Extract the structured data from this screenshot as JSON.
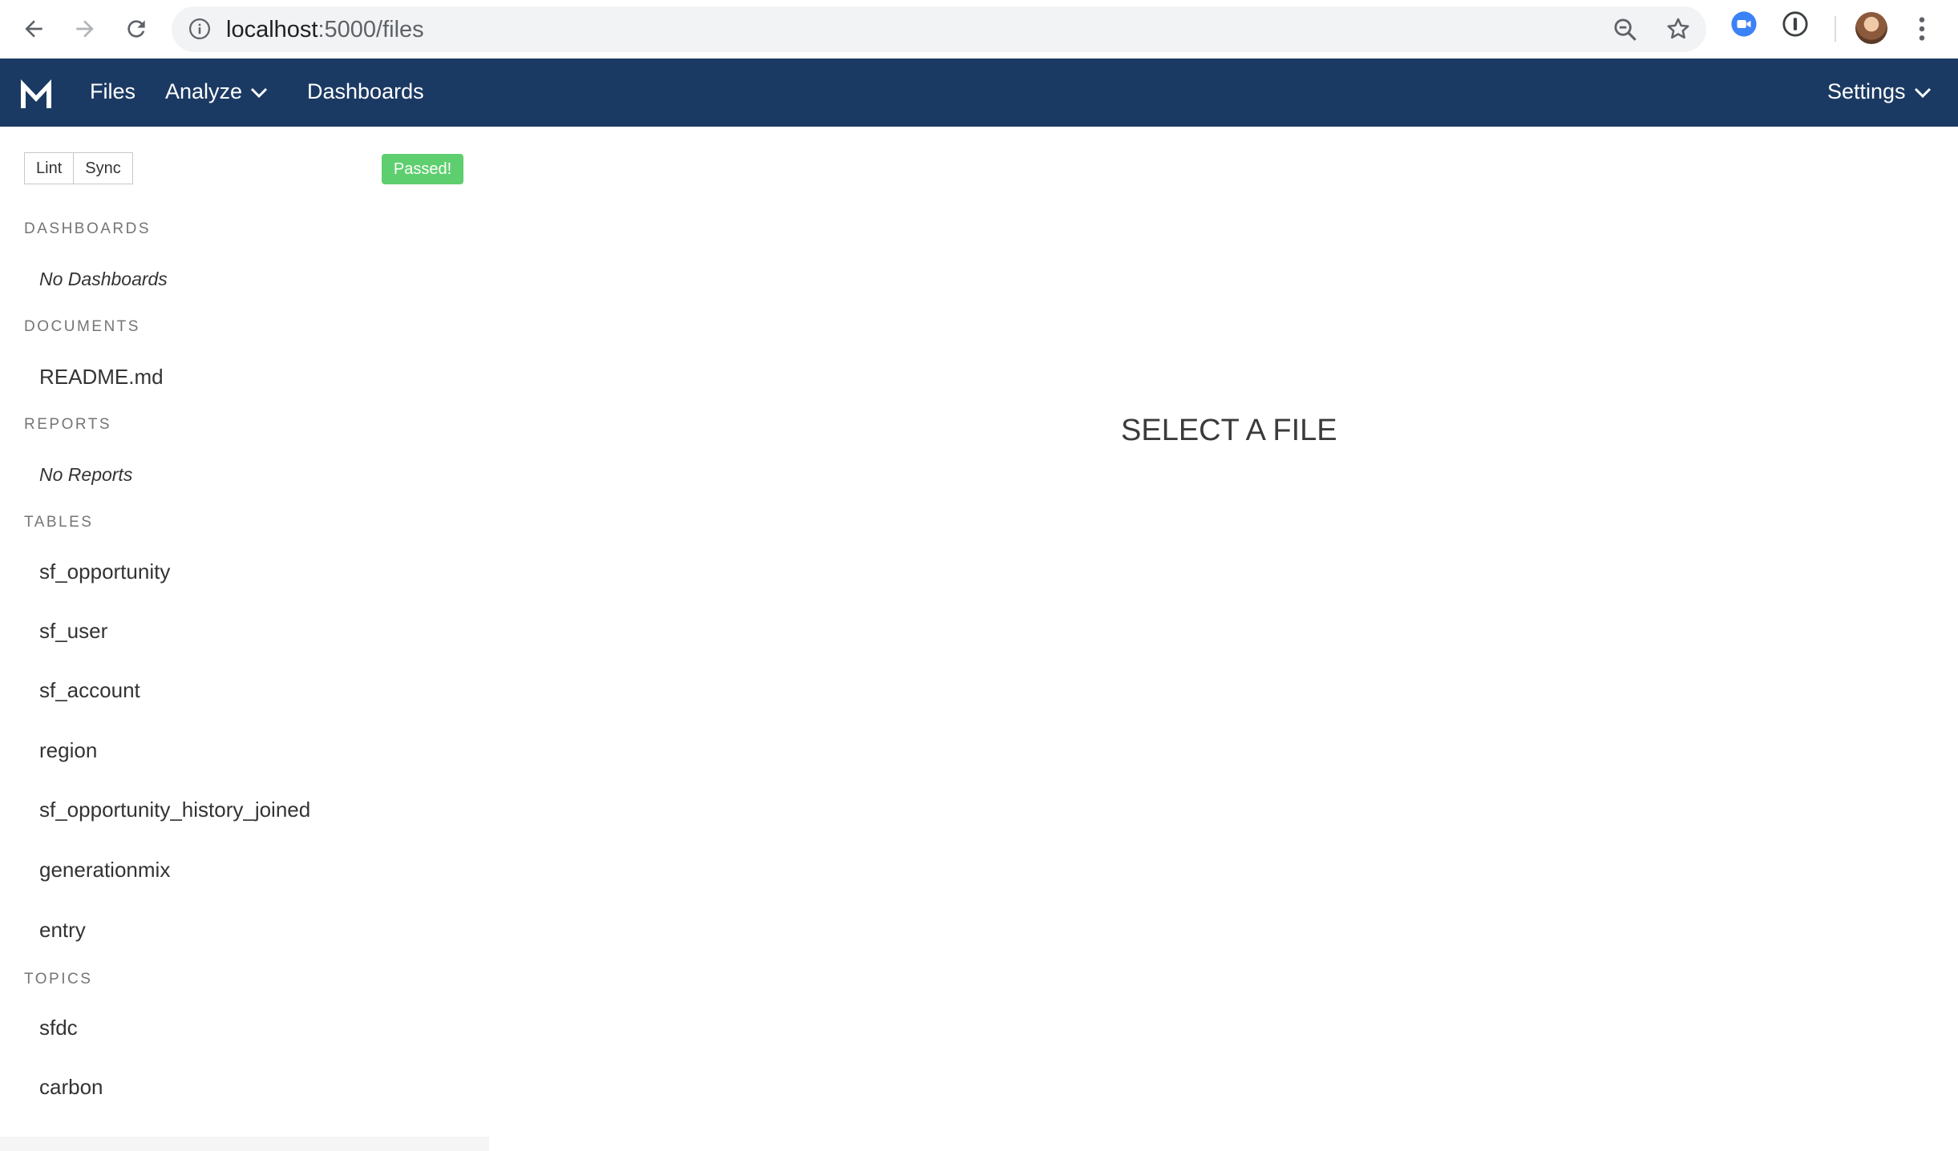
{
  "browser": {
    "url_host": "localhost",
    "url_path": ":5000/files"
  },
  "nav": {
    "items": [
      {
        "label": "Files"
      },
      {
        "label": "Analyze"
      },
      {
        "label": "Dashboards"
      }
    ],
    "settings_label": "Settings"
  },
  "sidebar": {
    "lint_label": "Lint",
    "sync_label": "Sync",
    "status_badge": "Passed!",
    "sections": {
      "dashboards": {
        "title": "DASHBOARDS",
        "empty": "No Dashboards"
      },
      "documents": {
        "title": "DOCUMENTS",
        "items": [
          "README.md"
        ]
      },
      "reports": {
        "title": "REPORTS",
        "empty": "No Reports"
      },
      "tables": {
        "title": "TABLES",
        "items": [
          "sf_opportunity",
          "sf_user",
          "sf_account",
          "region",
          "sf_opportunity_history_joined",
          "generationmix",
          "entry"
        ]
      },
      "topics": {
        "title": "TOPICS",
        "items": [
          "sfdc",
          "carbon"
        ]
      }
    }
  },
  "main": {
    "message": "SELECT A FILE"
  },
  "colors": {
    "nav_bg": "#1b3a63",
    "passed_badge": "#5ecf6e"
  }
}
